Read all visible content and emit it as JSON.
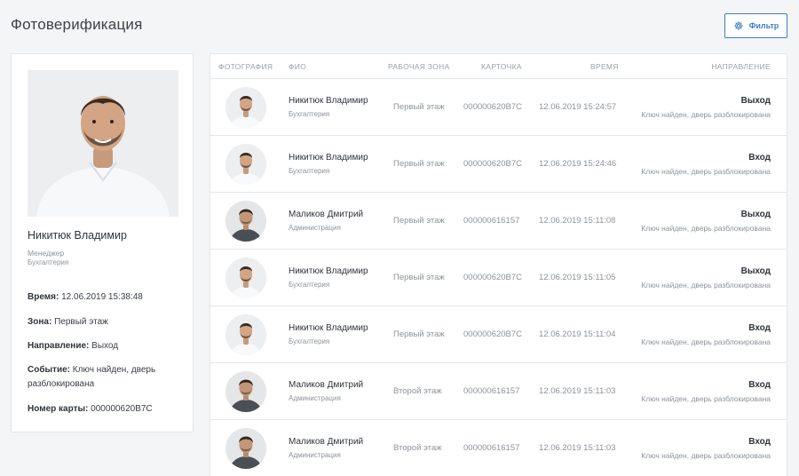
{
  "page": {
    "title": "Фотоверификация",
    "filter_label": "Фильтр"
  },
  "card": {
    "name": "Никитюк Владимир",
    "role": "Менеджер",
    "dept": "Бухгалтерия",
    "details": [
      {
        "label": "Время:",
        "value": "12.06.2019 15:38:48"
      },
      {
        "label": "Зона:",
        "value": "Первый этаж"
      },
      {
        "label": "Направление:",
        "value": "Выход"
      },
      {
        "label": "Событие:",
        "value": "Ключ найден, дверь разблокирована"
      },
      {
        "label": "Номер карты:",
        "value": "000000620B7C"
      }
    ]
  },
  "table": {
    "headers": {
      "photo": "ФОТОГРАФИЯ",
      "name": "ФИО",
      "zone": "РАБОЧАЯ ЗОНА",
      "card": "КАРТОЧКА",
      "time": "ВРЕМЯ",
      "direction": "НАПРАВЛЕНИЕ"
    },
    "rows": [
      {
        "name": "Никитюк Владимир",
        "dept": "Бухгалтерия",
        "zone": "Первый этаж",
        "card": "000000620B7C",
        "time": "12.06.2019 15:24:57",
        "direction": "Выход",
        "note": "Ключ найден, дверь разблокирована",
        "person": "a"
      },
      {
        "name": "Никитюк Владимир",
        "dept": "Бухгалтерия",
        "zone": "Первый этаж",
        "card": "000000620B7C",
        "time": "12.06.2019 15:24:46",
        "direction": "Вход",
        "note": "Ключ найден, дверь разблокирована",
        "person": "a"
      },
      {
        "name": "Маликов Дмитрий",
        "dept": "Администрация",
        "zone": "Первый этаж",
        "card": "000000616157",
        "time": "12.06.2019 15:11:08",
        "direction": "Выход",
        "note": "Ключ найден, дверь разблокирована",
        "person": "b"
      },
      {
        "name": "Никитюк Владимир",
        "dept": "Бухгалтерия",
        "zone": "Первый этаж",
        "card": "000000620B7C",
        "time": "12.06.2019 15:11:05",
        "direction": "Выход",
        "note": "Ключ найден, дверь разблокирована",
        "person": "a"
      },
      {
        "name": "Никитюк Владимир",
        "dept": "Бухгалтерия",
        "zone": "Первый этаж",
        "card": "000000620B7C",
        "time": "12.06.2019 15:11:04",
        "direction": "Вход",
        "note": "Ключ найден, дверь разблокирована",
        "person": "a"
      },
      {
        "name": "Маликов Дмитрий",
        "dept": "Администрация",
        "zone": "Второй этаж",
        "card": "000000616157",
        "time": "12.06.2019 15:11:03",
        "direction": "Вход",
        "note": "Ключ найден, дверь разблокирована",
        "person": "b"
      },
      {
        "name": "Маликов Дмитрий",
        "dept": "Администрация",
        "zone": "Второй этаж",
        "card": "000000616157",
        "time": "12.06.2019 15:11:03",
        "direction": "Вход",
        "note": "Ключ найден, дверь разблокирована",
        "person": "b"
      }
    ]
  }
}
